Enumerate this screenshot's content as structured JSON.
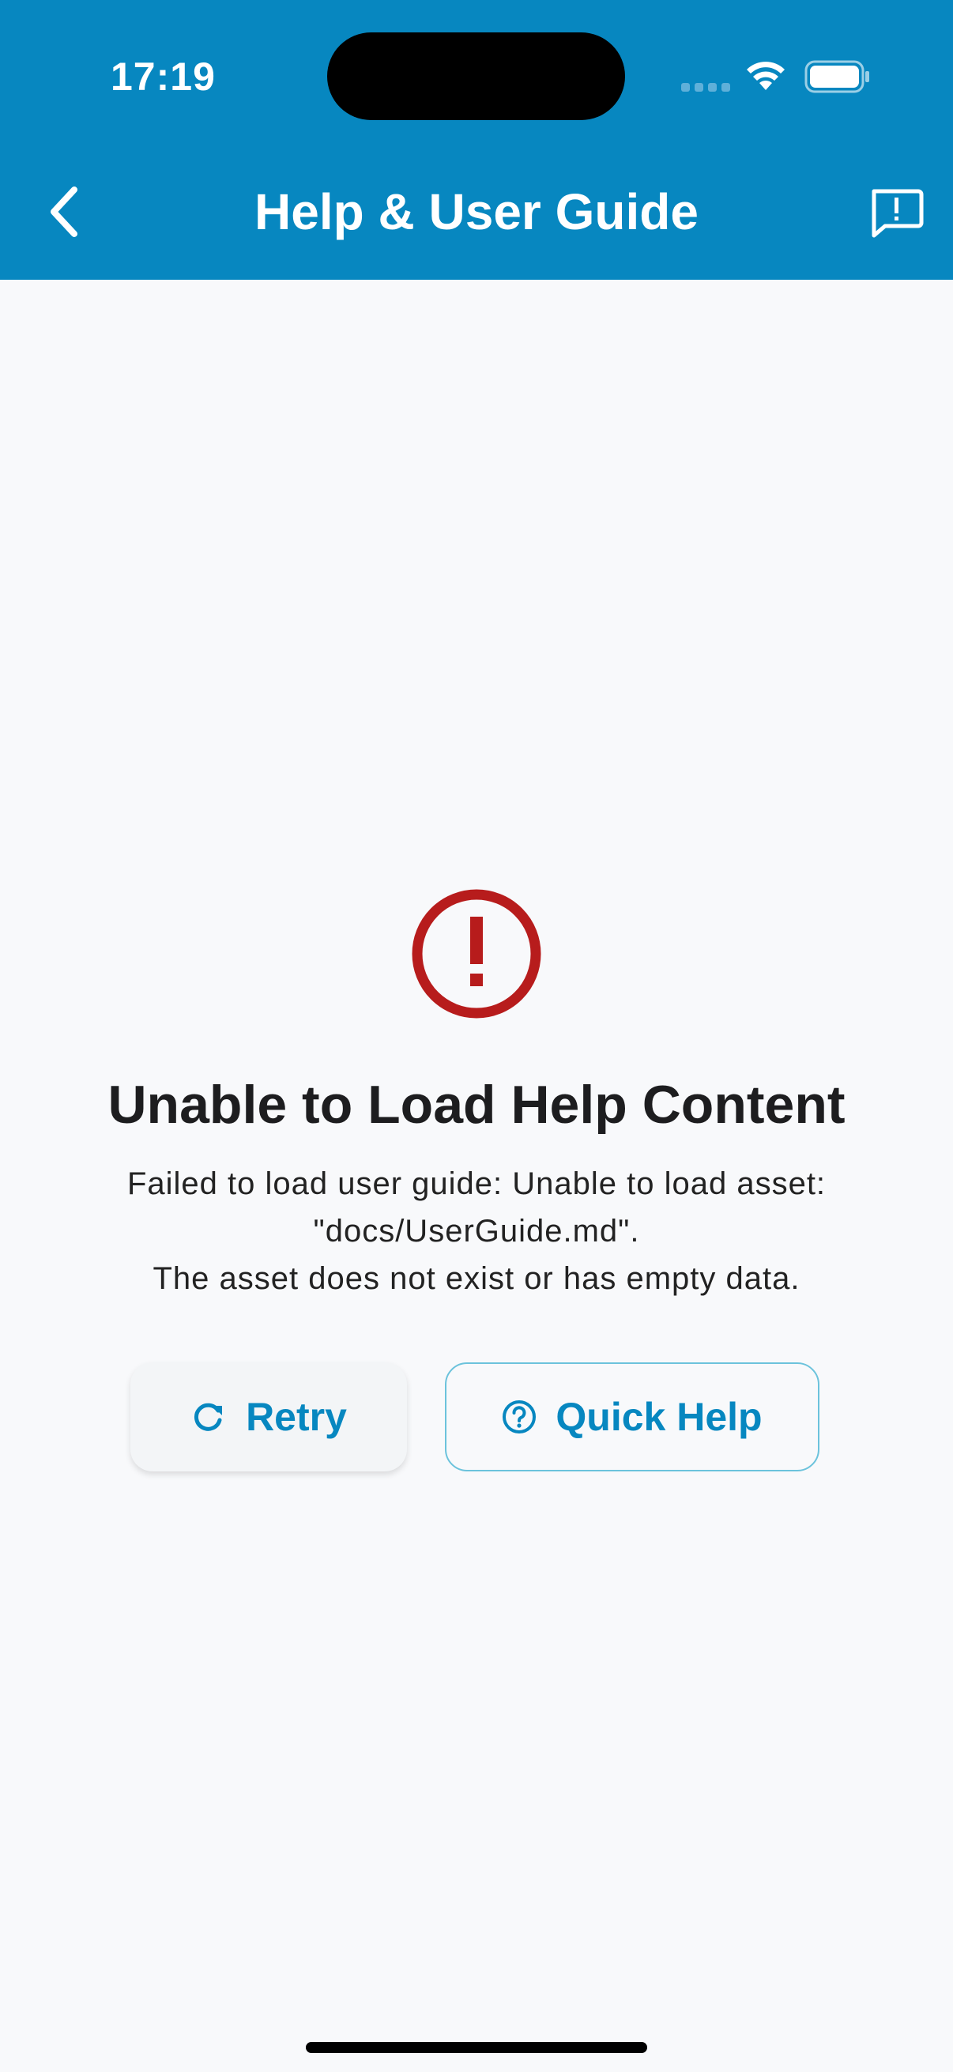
{
  "status_bar": {
    "time": "17:19",
    "icons": [
      "signal-dots-icon",
      "wifi-icon",
      "battery-icon"
    ]
  },
  "app_bar": {
    "title": "Help & User Guide",
    "back_icon": "chevron-left-icon",
    "action_icon": "feedback-icon",
    "background_color": "#0787c0"
  },
  "error": {
    "icon": "error-circle-icon",
    "icon_color": "#b71c1c",
    "title": "Unable to Load Help Content",
    "message_line1": "Failed to load user guide: Unable to load asset:",
    "message_line2": "\"docs/UserGuide.md\".",
    "message_line3": "The asset does not exist or has empty data."
  },
  "actions": {
    "retry_label": "Retry",
    "retry_icon": "refresh-icon",
    "quick_help_label": "Quick Help",
    "quick_help_icon": "help-circle-icon",
    "accent_color": "#0787c0"
  }
}
